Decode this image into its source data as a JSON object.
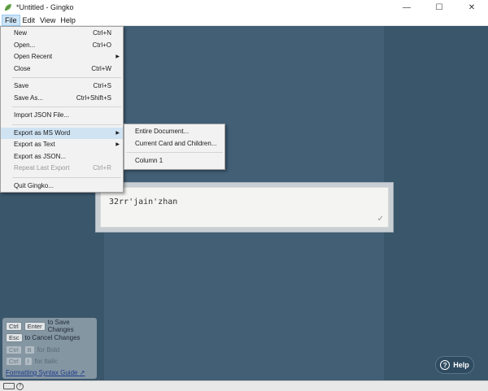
{
  "window": {
    "title": "*Untitled - Gingko",
    "minimize": "—",
    "maximize": "☐",
    "close": "✕"
  },
  "menubar": [
    "File",
    "Edit",
    "View",
    "Help"
  ],
  "file_menu": {
    "new": {
      "label": "New",
      "shortcut": "Ctrl+N"
    },
    "open": {
      "label": "Open...",
      "shortcut": "Ctrl+O"
    },
    "open_recent": {
      "label": "Open Recent"
    },
    "close": {
      "label": "Close",
      "shortcut": "Ctrl+W"
    },
    "save": {
      "label": "Save",
      "shortcut": "Ctrl+S"
    },
    "save_as": {
      "label": "Save As...",
      "shortcut": "Ctrl+Shift+S"
    },
    "import_json": {
      "label": "Import JSON File..."
    },
    "export_word": {
      "label": "Export as MS Word"
    },
    "export_text": {
      "label": "Export as Text"
    },
    "export_json": {
      "label": "Export as JSON..."
    },
    "repeat_export": {
      "label": "Repeat Last Export",
      "shortcut": "Ctrl+R"
    },
    "quit": {
      "label": "Quit Gingko..."
    }
  },
  "export_submenu": {
    "entire": "Entire Document...",
    "current": "Current Card and Children...",
    "column": "Column 1"
  },
  "card": {
    "text": "32rr'jain'zhan",
    "check": "✓"
  },
  "hints": {
    "save": {
      "k1": "Ctrl",
      "k2": "Enter",
      "text": "to Save Changes"
    },
    "cancel": {
      "k1": "Esc",
      "text": "to Cancel Changes"
    },
    "bold": {
      "k1": "Ctrl",
      "k2": "B",
      "text": "for Bold"
    },
    "italic": {
      "k1": "Ctrl",
      "k2": "I",
      "text": "for Italic"
    },
    "link": "Formatting Syntax Guide"
  },
  "help_button": {
    "label": "Help",
    "icon": "?"
  },
  "statusbar": {
    "q": "?"
  },
  "colors": {
    "background": "#3d5a70",
    "column_mid": "#425f75",
    "menu_hover": "#cfe3f3"
  }
}
